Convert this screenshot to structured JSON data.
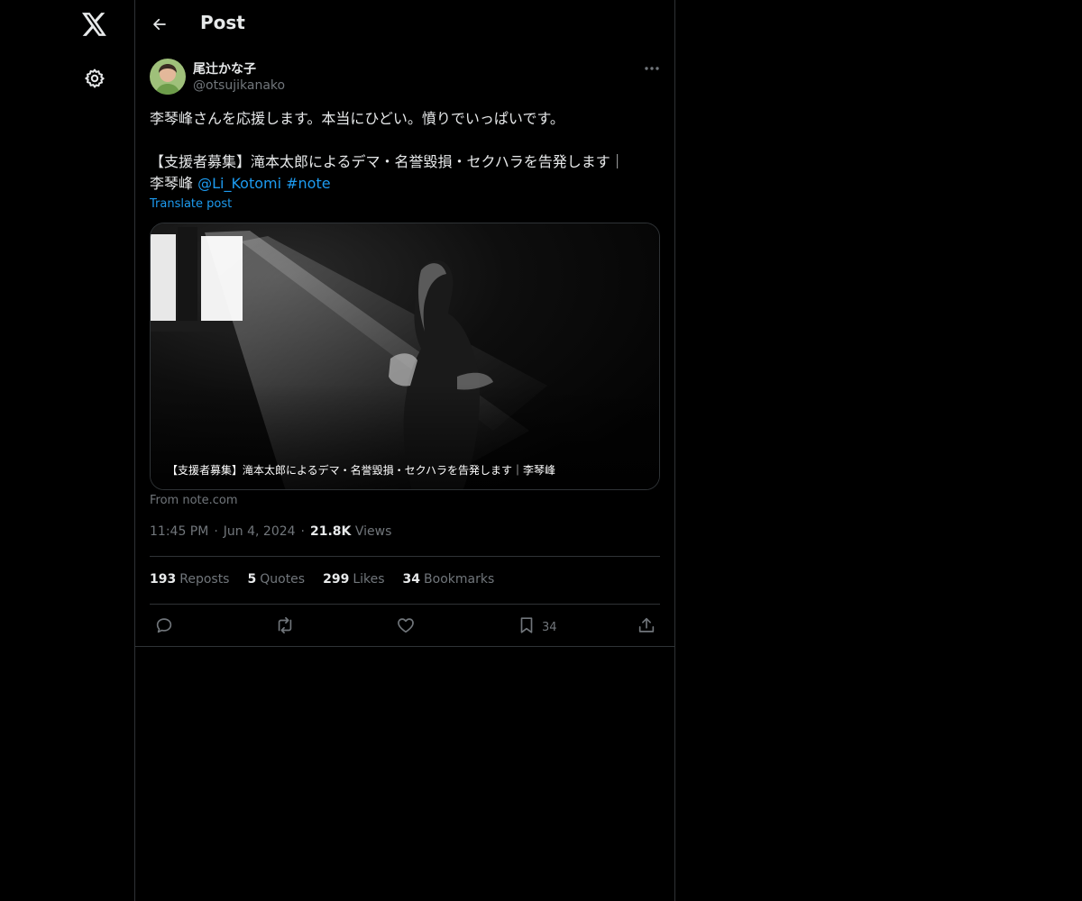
{
  "nav": {
    "logo_icon": "x-logo-icon",
    "settings_icon": "gear-icon"
  },
  "header": {
    "title": "Post",
    "back_icon": "arrow-left-icon"
  },
  "post": {
    "author": {
      "name": "尾辻かな子",
      "handle": "@otsujikanako"
    },
    "text": {
      "line1": "李琴峰さんを応援します。本当にひどい。憤りでいっぱいです。",
      "line2": "【支援者募集】滝本太郎によるデマ・名誉毀損・セクハラを告発します｜",
      "line3_prefix": "李琴峰 ",
      "mention": "@Li_Kotomi",
      "hashtag": "#note"
    },
    "translate_label": "Translate post",
    "card": {
      "caption": "【支援者募集】滝本太郎によるデマ・名誉毀損・セクハラを告発します｜李琴峰"
    },
    "source": "From note.com",
    "time": "11:45 PM",
    "date": "Jun 4, 2024",
    "views_count": "21.8K",
    "views_label": "Views",
    "dot": "·"
  },
  "stats": {
    "reposts_count": "193",
    "reposts_label": "Reposts",
    "quotes_count": "5",
    "quotes_label": "Quotes",
    "likes_count": "299",
    "likes_label": "Likes",
    "bookmarks_count": "34",
    "bookmarks_label": "Bookmarks"
  },
  "actions": {
    "reply_icon": "reply-icon",
    "repost_icon": "repost-icon",
    "like_icon": "heart-icon",
    "bookmark_icon": "bookmark-icon",
    "bookmark_count": "34",
    "share_icon": "share-icon"
  },
  "colors": {
    "background": "#000000",
    "text": "#e7e9ea",
    "secondary": "#71767b",
    "link": "#1d9bf0",
    "border": "#2f3336"
  }
}
